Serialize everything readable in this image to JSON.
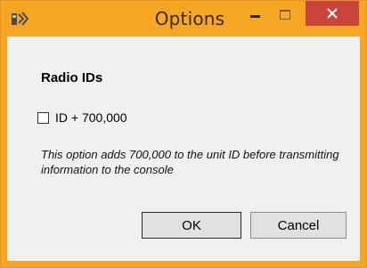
{
  "window": {
    "title": "Options",
    "accent_color": "#f5a623",
    "close_color": "#c9443b",
    "icons": {
      "app": "radio-app-icon",
      "minimize": "minimize-icon",
      "maximize": "maximize-icon",
      "close": "close-icon"
    }
  },
  "section": {
    "title": "Radio IDs"
  },
  "option": {
    "label": "ID + 700,000",
    "checked": false,
    "description": "This option adds 700,000 to the unit ID before transmitting information to the console"
  },
  "buttons": {
    "ok_label": "OK",
    "cancel_label": "Cancel"
  }
}
